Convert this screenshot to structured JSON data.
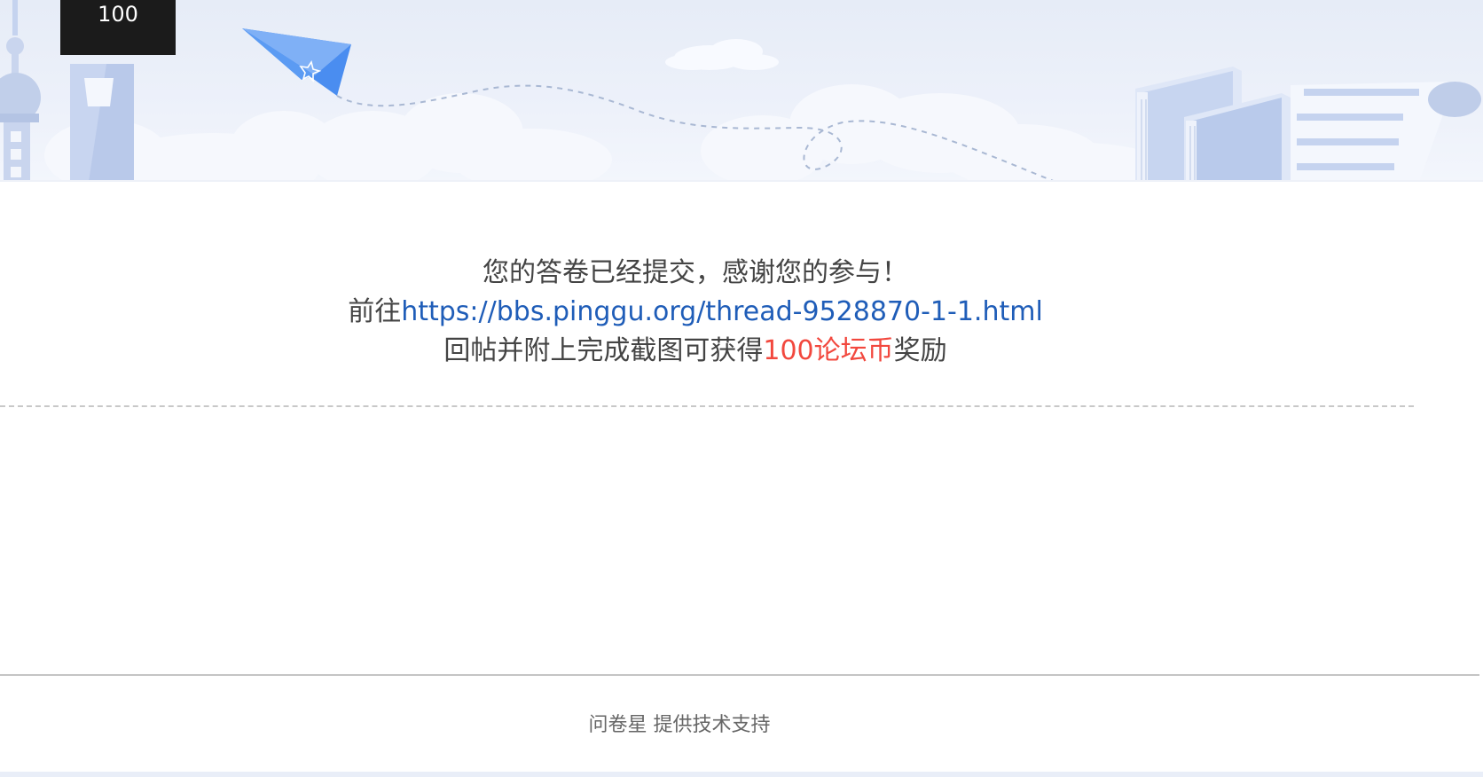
{
  "banner": {
    "score_value": "100",
    "icons": [
      "tower-icon",
      "skyscraper-icon",
      "paper-plane-icon",
      "cloud-icon",
      "books-icon",
      "scroll-icon"
    ],
    "colors": {
      "sky": "#e6ecf7",
      "cloud": "#f6f8fd",
      "building": "#c5d3ef",
      "plane": "#4a8df0",
      "dashed_path": "#a9b8d3"
    }
  },
  "message": {
    "line1": "您的答卷已经提交，感谢您的参与！",
    "line2_prefix": "前往",
    "link_text": "https://bbs.pinggu.org/thread-9528870-1-1.html",
    "line3_prefix": "回帖并附上完成截图可获得",
    "reward": "100论坛币",
    "line3_suffix": "奖励",
    "colors": {
      "text": "#444444",
      "link": "#1f5db8",
      "reward": "#f2483e"
    }
  },
  "footer": {
    "brand": "问卷星",
    "text": "提供技术支持"
  }
}
